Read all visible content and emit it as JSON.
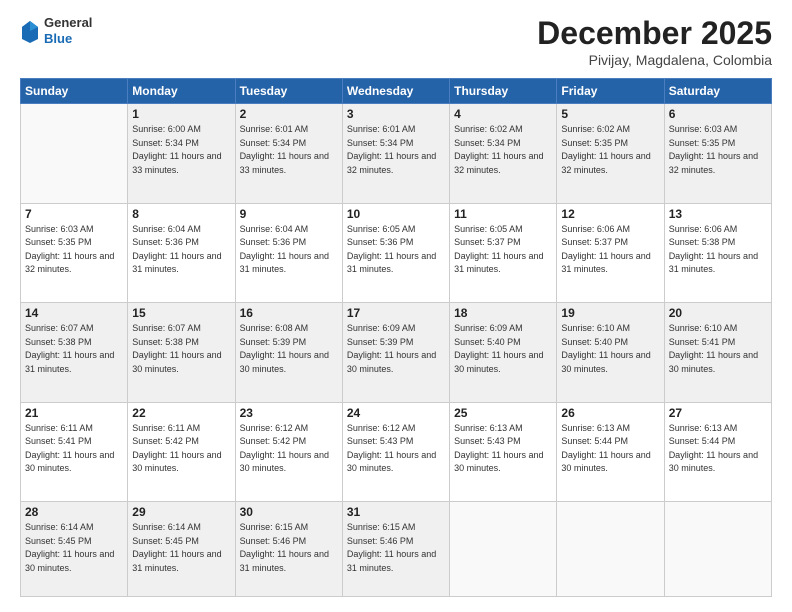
{
  "logo": {
    "general": "General",
    "blue": "Blue"
  },
  "title": "December 2025",
  "subtitle": "Pivijay, Magdalena, Colombia",
  "header_days": [
    "Sunday",
    "Monday",
    "Tuesday",
    "Wednesday",
    "Thursday",
    "Friday",
    "Saturday"
  ],
  "weeks": [
    [
      {
        "day": "",
        "sunrise": "",
        "sunset": "",
        "daylight": ""
      },
      {
        "day": "1",
        "sunrise": "6:00 AM",
        "sunset": "5:34 PM",
        "daylight": "11 hours and 33 minutes."
      },
      {
        "day": "2",
        "sunrise": "6:01 AM",
        "sunset": "5:34 PM",
        "daylight": "11 hours and 33 minutes."
      },
      {
        "day": "3",
        "sunrise": "6:01 AM",
        "sunset": "5:34 PM",
        "daylight": "11 hours and 32 minutes."
      },
      {
        "day": "4",
        "sunrise": "6:02 AM",
        "sunset": "5:34 PM",
        "daylight": "11 hours and 32 minutes."
      },
      {
        "day": "5",
        "sunrise": "6:02 AM",
        "sunset": "5:35 PM",
        "daylight": "11 hours and 32 minutes."
      },
      {
        "day": "6",
        "sunrise": "6:03 AM",
        "sunset": "5:35 PM",
        "daylight": "11 hours and 32 minutes."
      }
    ],
    [
      {
        "day": "7",
        "sunrise": "6:03 AM",
        "sunset": "5:35 PM",
        "daylight": "11 hours and 32 minutes."
      },
      {
        "day": "8",
        "sunrise": "6:04 AM",
        "sunset": "5:36 PM",
        "daylight": "11 hours and 31 minutes."
      },
      {
        "day": "9",
        "sunrise": "6:04 AM",
        "sunset": "5:36 PM",
        "daylight": "11 hours and 31 minutes."
      },
      {
        "day": "10",
        "sunrise": "6:05 AM",
        "sunset": "5:36 PM",
        "daylight": "11 hours and 31 minutes."
      },
      {
        "day": "11",
        "sunrise": "6:05 AM",
        "sunset": "5:37 PM",
        "daylight": "11 hours and 31 minutes."
      },
      {
        "day": "12",
        "sunrise": "6:06 AM",
        "sunset": "5:37 PM",
        "daylight": "11 hours and 31 minutes."
      },
      {
        "day": "13",
        "sunrise": "6:06 AM",
        "sunset": "5:38 PM",
        "daylight": "11 hours and 31 minutes."
      }
    ],
    [
      {
        "day": "14",
        "sunrise": "6:07 AM",
        "sunset": "5:38 PM",
        "daylight": "11 hours and 31 minutes."
      },
      {
        "day": "15",
        "sunrise": "6:07 AM",
        "sunset": "5:38 PM",
        "daylight": "11 hours and 30 minutes."
      },
      {
        "day": "16",
        "sunrise": "6:08 AM",
        "sunset": "5:39 PM",
        "daylight": "11 hours and 30 minutes."
      },
      {
        "day": "17",
        "sunrise": "6:09 AM",
        "sunset": "5:39 PM",
        "daylight": "11 hours and 30 minutes."
      },
      {
        "day": "18",
        "sunrise": "6:09 AM",
        "sunset": "5:40 PM",
        "daylight": "11 hours and 30 minutes."
      },
      {
        "day": "19",
        "sunrise": "6:10 AM",
        "sunset": "5:40 PM",
        "daylight": "11 hours and 30 minutes."
      },
      {
        "day": "20",
        "sunrise": "6:10 AM",
        "sunset": "5:41 PM",
        "daylight": "11 hours and 30 minutes."
      }
    ],
    [
      {
        "day": "21",
        "sunrise": "6:11 AM",
        "sunset": "5:41 PM",
        "daylight": "11 hours and 30 minutes."
      },
      {
        "day": "22",
        "sunrise": "6:11 AM",
        "sunset": "5:42 PM",
        "daylight": "11 hours and 30 minutes."
      },
      {
        "day": "23",
        "sunrise": "6:12 AM",
        "sunset": "5:42 PM",
        "daylight": "11 hours and 30 minutes."
      },
      {
        "day": "24",
        "sunrise": "6:12 AM",
        "sunset": "5:43 PM",
        "daylight": "11 hours and 30 minutes."
      },
      {
        "day": "25",
        "sunrise": "6:13 AM",
        "sunset": "5:43 PM",
        "daylight": "11 hours and 30 minutes."
      },
      {
        "day": "26",
        "sunrise": "6:13 AM",
        "sunset": "5:44 PM",
        "daylight": "11 hours and 30 minutes."
      },
      {
        "day": "27",
        "sunrise": "6:13 AM",
        "sunset": "5:44 PM",
        "daylight": "11 hours and 30 minutes."
      }
    ],
    [
      {
        "day": "28",
        "sunrise": "6:14 AM",
        "sunset": "5:45 PM",
        "daylight": "11 hours and 30 minutes."
      },
      {
        "day": "29",
        "sunrise": "6:14 AM",
        "sunset": "5:45 PM",
        "daylight": "11 hours and 31 minutes."
      },
      {
        "day": "30",
        "sunrise": "6:15 AM",
        "sunset": "5:46 PM",
        "daylight": "11 hours and 31 minutes."
      },
      {
        "day": "31",
        "sunrise": "6:15 AM",
        "sunset": "5:46 PM",
        "daylight": "11 hours and 31 minutes."
      },
      {
        "day": "",
        "sunrise": "",
        "sunset": "",
        "daylight": ""
      },
      {
        "day": "",
        "sunrise": "",
        "sunset": "",
        "daylight": ""
      },
      {
        "day": "",
        "sunrise": "",
        "sunset": "",
        "daylight": ""
      }
    ]
  ]
}
